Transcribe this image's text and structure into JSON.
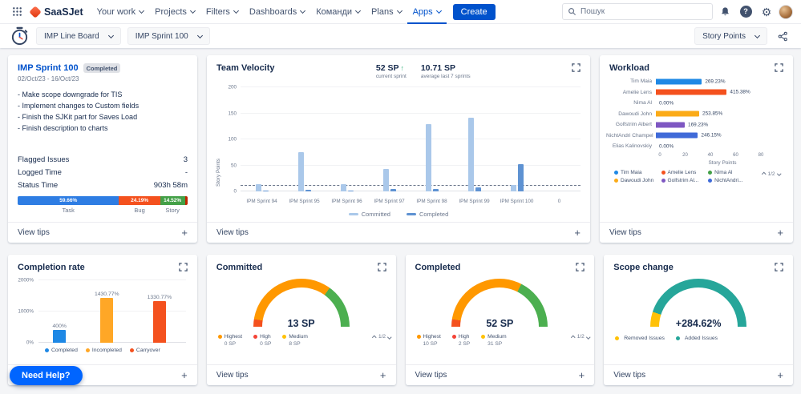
{
  "nav": {
    "logo_text": "SaaSJet",
    "items": [
      {
        "label": "Your work"
      },
      {
        "label": "Projects"
      },
      {
        "label": "Filters"
      },
      {
        "label": "Dashboards"
      },
      {
        "label": "Команди"
      },
      {
        "label": "Plans"
      },
      {
        "label": "Apps",
        "active": true
      }
    ],
    "create_label": "Create",
    "search_placeholder": "Пошук"
  },
  "toolbar": {
    "board_select": "IMP Line Board",
    "sprint_select": "IMP Sprint 100",
    "metric_select": "Story Points"
  },
  "labels": {
    "view_tips": "View tips",
    "need_help": "Need Help?"
  },
  "sprint_card": {
    "title": "IMP Sprint 100",
    "badge": "Completed",
    "dates": "02/Oct/23 - 16/Oct/23",
    "goals": [
      "- Make scope downgrade for TIS",
      "- Implement changes to Custom fields",
      "- Finish the SJKit part for Saves Load",
      "- Finish description to charts"
    ],
    "stats": [
      {
        "label": "Flagged Issues",
        "value": "3"
      },
      {
        "label": "Logged Time",
        "value": "-"
      },
      {
        "label": "Status Time",
        "value": "903h 58m"
      }
    ],
    "distribution": [
      {
        "label": "Task",
        "pct": "59.66%",
        "value": 59.66,
        "color": "#2e7de3"
      },
      {
        "label": "Bug",
        "pct": "24.19%",
        "value": 24.19,
        "color": "#f4511e"
      },
      {
        "label": "Story",
        "pct": "14.52%",
        "value": 14.52,
        "color": "#43a047"
      },
      {
        "label": "",
        "pct": "",
        "value": 1.63,
        "color": "#bf2600"
      }
    ]
  },
  "team_velocity": {
    "title": "Team Velocity",
    "current_value": "52 SP",
    "current_arrow": "↑",
    "current_label": "current sprint",
    "average_value": "10.71 SP",
    "average_label": "average last 7 sprints",
    "ylabel": "Story Points",
    "ymax": 200,
    "yticks": [
      0,
      50,
      100,
      150,
      200
    ],
    "average_line": 10.71,
    "categories": [
      "IPM Sprint 94",
      "IPM Sprint 95",
      "IPM Sprint 96",
      "IPM Sprint 97",
      "IPM Sprint 98",
      "IPM Sprint 99",
      "IPM Sprint 100",
      "0"
    ],
    "series": [
      {
        "name": "Committed",
        "color": "#aac8ea",
        "values": [
          14,
          75,
          14,
          43,
          130,
          141,
          13,
          0
        ]
      },
      {
        "name": "Completed",
        "color": "#5e92d2",
        "values": [
          2,
          3,
          2,
          5,
          4,
          7,
          52,
          0
        ]
      }
    ]
  },
  "workload": {
    "title": "Workload",
    "xlabel": "Story Points",
    "xmax": 80,
    "xticks": [
      0,
      20,
      40,
      60,
      80
    ],
    "rows": [
      {
        "name": "Tim Maia",
        "pct": "269.23%",
        "value": 35,
        "color": "#1e88e5"
      },
      {
        "name": "Amelie Lens",
        "pct": "415.38%",
        "value": 54,
        "color": "#f4511e"
      },
      {
        "name": "Nima Al",
        "pct": "0.00%",
        "value": 0,
        "color": "#43a047"
      },
      {
        "name": "Dawoudi John",
        "pct": "253.85%",
        "value": 33,
        "color": "#fbab18"
      },
      {
        "name": "Golfstrim Albert",
        "pct": "169.23%",
        "value": 22,
        "color": "#7e57c2"
      },
      {
        "name": "NichtAndri Champel",
        "pct": "246.15%",
        "value": 32,
        "color": "#3f6ad8"
      },
      {
        "name": "Elias Kalinovskiy",
        "pct": "0.00%",
        "value": 0,
        "color": "#26a69a"
      }
    ],
    "legend": [
      {
        "label": "Tim Maia",
        "color": "#1e88e5"
      },
      {
        "label": "Amelie Lens",
        "color": "#f4511e"
      },
      {
        "label": "Nima Al",
        "color": "#43a047"
      },
      {
        "label": "Dawoudi John",
        "color": "#fbab18"
      },
      {
        "label": "Golfstrim Al...",
        "color": "#7e57c2"
      },
      {
        "label": "NichtAndri...",
        "color": "#3f6ad8"
      }
    ],
    "pagination": "1/2"
  },
  "completion_rate": {
    "title": "Completion rate",
    "ymax": 2000,
    "yticks": [
      {
        "label": "0%",
        "value": 0
      },
      {
        "label": "1000%",
        "value": 1000
      },
      {
        "label": "2000%",
        "value": 2000
      }
    ],
    "bars": [
      {
        "label": "Completed",
        "pct": "400%",
        "value": 400,
        "color": "#1e88e5"
      },
      {
        "label": "Incompleted",
        "pct": "1430.77%",
        "value": 1430.77,
        "color": "#ffa726"
      },
      {
        "label": "Carryover",
        "pct": "1330.77%",
        "value": 1330.77,
        "color": "#f4511e"
      }
    ]
  },
  "committed_gauge": {
    "title": "Committed",
    "value": "13 SP",
    "segments": [
      {
        "color": "#f4511e",
        "value": 5
      },
      {
        "color": "#ff9800",
        "value": 65
      },
      {
        "color": "#4caf50",
        "value": 30
      }
    ],
    "legend": [
      {
        "label": "Highest",
        "value": "0 SP",
        "color": "#ff9800"
      },
      {
        "label": "High",
        "value": "0 SP",
        "color": "#f44336"
      },
      {
        "label": "Medium",
        "value": "8 SP",
        "color": "#ffc107"
      }
    ],
    "pagination": "1/2"
  },
  "completed_gauge": {
    "title": "Completed",
    "value": "52 SP",
    "segments": [
      {
        "color": "#f4511e",
        "value": 5
      },
      {
        "color": "#ff9800",
        "value": 60
      },
      {
        "color": "#4caf50",
        "value": 35
      }
    ],
    "legend": [
      {
        "label": "Highest",
        "value": "10 SP",
        "color": "#ff9800"
      },
      {
        "label": "High",
        "value": "2 SP",
        "color": "#f44336"
      },
      {
        "label": "Medium",
        "value": "31 SP",
        "color": "#ffc107"
      }
    ],
    "pagination": "1/2"
  },
  "scope_change": {
    "title": "Scope change",
    "value": "+284.62%",
    "segments": [
      {
        "color": "#ffc107",
        "value": 10
      },
      {
        "color": "#26a69a",
        "value": 90
      }
    ],
    "legend": [
      {
        "label": "Removed Issues",
        "color": "#ffc107"
      },
      {
        "label": "Added Issues",
        "color": "#26a69a"
      }
    ]
  }
}
